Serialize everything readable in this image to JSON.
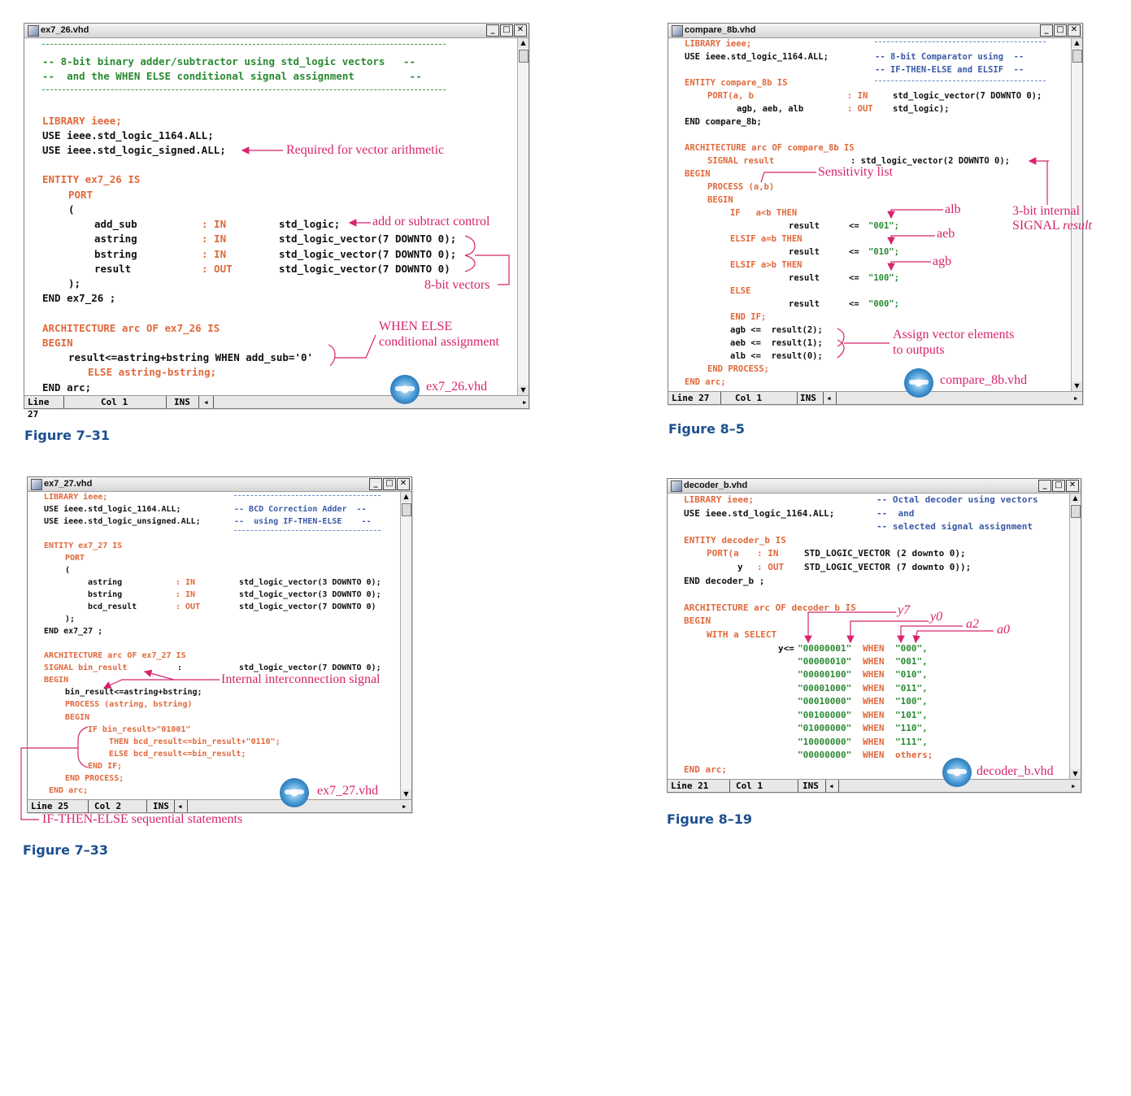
{
  "figures": {
    "fig731": {
      "window_title": "ex7_26.vhd",
      "status": {
        "line_label": "Line",
        "line": "27",
        "col_label": "Col",
        "col": "1",
        "mode": "INS"
      },
      "caption": "Figure 7–31",
      "cd_label": "ex7_26.vhd",
      "annotations": {
        "vector_arith": "Required for vector arithmetic",
        "add_sub": "add or subtract control",
        "vectors": "8-bit vectors",
        "when_else_1": "WHEN ELSE",
        "when_else_2": "conditional assignment"
      }
    },
    "fig85": {
      "window_title": "compare_8b.vhd",
      "status": {
        "line_label": "Line",
        "line": "27",
        "col_label": "Col",
        "col": "1",
        "mode": "INS"
      },
      "caption": "Figure 8–5",
      "cd_label": "compare_8b.vhd",
      "annotations": {
        "sens": "Sensitivity list",
        "alb": "alb",
        "aeb": "aeb",
        "agb": "agb",
        "internal_1": "3-bit internal",
        "internal_2a": "SIGNAL ",
        "internal_2b": "result",
        "assign_1": "Assign vector elements",
        "assign_2": "to outputs"
      }
    },
    "fig733": {
      "window_title": "ex7_27.vhd",
      "status": {
        "line_label": "Line",
        "line": "25",
        "col_label": "Col",
        "col": "2",
        "mode": "INS"
      },
      "caption": "Figure 7–33",
      "cd_label": "ex7_27.vhd",
      "annotations": {
        "internal": "Internal interconnection signal",
        "ifthen": "IF-THEN-ELSE sequential statements"
      }
    },
    "fig819": {
      "window_title": "decoder_b.vhd",
      "status": {
        "line_label": "Line",
        "line": "21",
        "col_label": "Col",
        "col": "1",
        "mode": "INS"
      },
      "caption": "Figure 8–19",
      "cd_label": "decoder_b.vhd",
      "annotations": {
        "y7": "y7",
        "y0": "y0",
        "a2": "a2",
        "a0": "a0"
      }
    }
  },
  "code": {
    "ex7_26": [
      "-- 8-bit binary adder/subtractor using std_logic vectors   --",
      "--  and the WHEN ELSE conditional signal assignment         --",
      "LIBRARY ieee;",
      "USE ieee.std_logic_1164.ALL;",
      "USE ieee.std_logic_signed.ALL;",
      "ENTITY ex7_26 IS",
      "PORT",
      "(",
      "add_sub",
      ": IN",
      "std_logic;",
      "astring",
      "std_logic_vector(7 DOWNTO 0);",
      "bstring",
      "result",
      ": OUT",
      "std_logic_vector(7 DOWNTO 0)",
      ");",
      "END ex7_26 ;",
      "ARCHITECTURE arc OF ex7_26 IS",
      "BEGIN",
      "result<=astring+bstring WHEN add_sub='0'",
      "ELSE astring-bstring;",
      "END arc;"
    ],
    "compare_8b": [
      "LIBRARY ieee;",
      "USE ieee.std_logic_1164.ALL;",
      "-- 8-bit Comparator using  --",
      "-- IF-THEN-ELSE and ELSIF  --",
      "ENTITY compare_8b IS",
      "PORT(a, b",
      ": IN",
      "std_logic_vector(7 DOWNTO 0);",
      "agb, aeb, alb",
      ": OUT",
      "std_logic);",
      "END compare_8b;",
      "ARCHITECTURE arc OF compare_8b IS",
      "SIGNAL result",
      ": std_logic_vector(2 DOWNTO 0);",
      "BEGIN",
      "PROCESS (a,b)",
      "BEGIN",
      "IF   a<b THEN",
      "result",
      "<=",
      "\"001\";",
      "ELSIF a=b THEN",
      "\"010\";",
      "ELSIF a>b THEN",
      "\"100\";",
      "ELSE",
      "\"000\";",
      "END IF;",
      "agb <=  result(2);",
      "aeb <=  result(1);",
      "alb <=  result(0);",
      "END PROCESS;",
      "END arc;"
    ],
    "ex7_27": [
      "LIBRARY ieee;",
      "USE ieee.std_logic_1164.ALL;",
      "USE ieee.std_logic_unsigned.ALL;",
      "-- BCD Correction Adder  --",
      "--  using IF-THEN-ELSE    --",
      "ENTITY ex7_27 IS",
      "PORT",
      "(",
      "astring",
      ": IN",
      "std_logic_vector(3 DOWNTO 0);",
      "bstring",
      "bcd_result",
      ": OUT",
      "std_logic_vector(7 DOWNTO 0)",
      ");",
      "END ex7_27 ;",
      "ARCHITECTURE arc OF ex7_27 IS",
      "SIGNAL bin_result",
      ":",
      "std_logic_vector(7 DOWNTO 0);",
      "BEGIN",
      "bin_result<=astring+bstring;",
      "PROCESS (astring, bstring)",
      "BEGIN",
      "IF bin_result>\"01001\"",
      "THEN bcd_result<=bin_result+\"0110\";",
      "ELSE bcd_result<=bin_result;",
      "END IF;",
      "END PROCESS;",
      "END arc;"
    ],
    "decoder_b": [
      "LIBRARY ieee;",
      "USE ieee.std_logic_1164.ALL;",
      "-- Octal decoder using vectors",
      "--  and",
      "-- selected signal assignment",
      "ENTITY decoder_b IS",
      "PORT(a",
      ": IN",
      "STD_LOGIC_VECTOR (2 downto 0);",
      "y",
      ": OUT",
      "STD_LOGIC_VECTOR (7 downto 0));",
      "END decoder_b ;",
      "ARCHITECTURE arc OF decoder_b IS",
      "BEGIN",
      "WITH a SELECT",
      "y<=",
      "\"00000001\"",
      "WHEN",
      "\"000\",",
      "\"00000010\"",
      "\"001\",",
      "\"00000100\"",
      "\"010\",",
      "\"00001000\"",
      "\"011\",",
      "\"00010000\"",
      "\"100\",",
      "\"00100000\"",
      "\"101\",",
      "\"01000000\"",
      "\"110\",",
      "\"10000000\"",
      "\"111\",",
      "\"00000000\"",
      "others;",
      "END arc;"
    ]
  }
}
